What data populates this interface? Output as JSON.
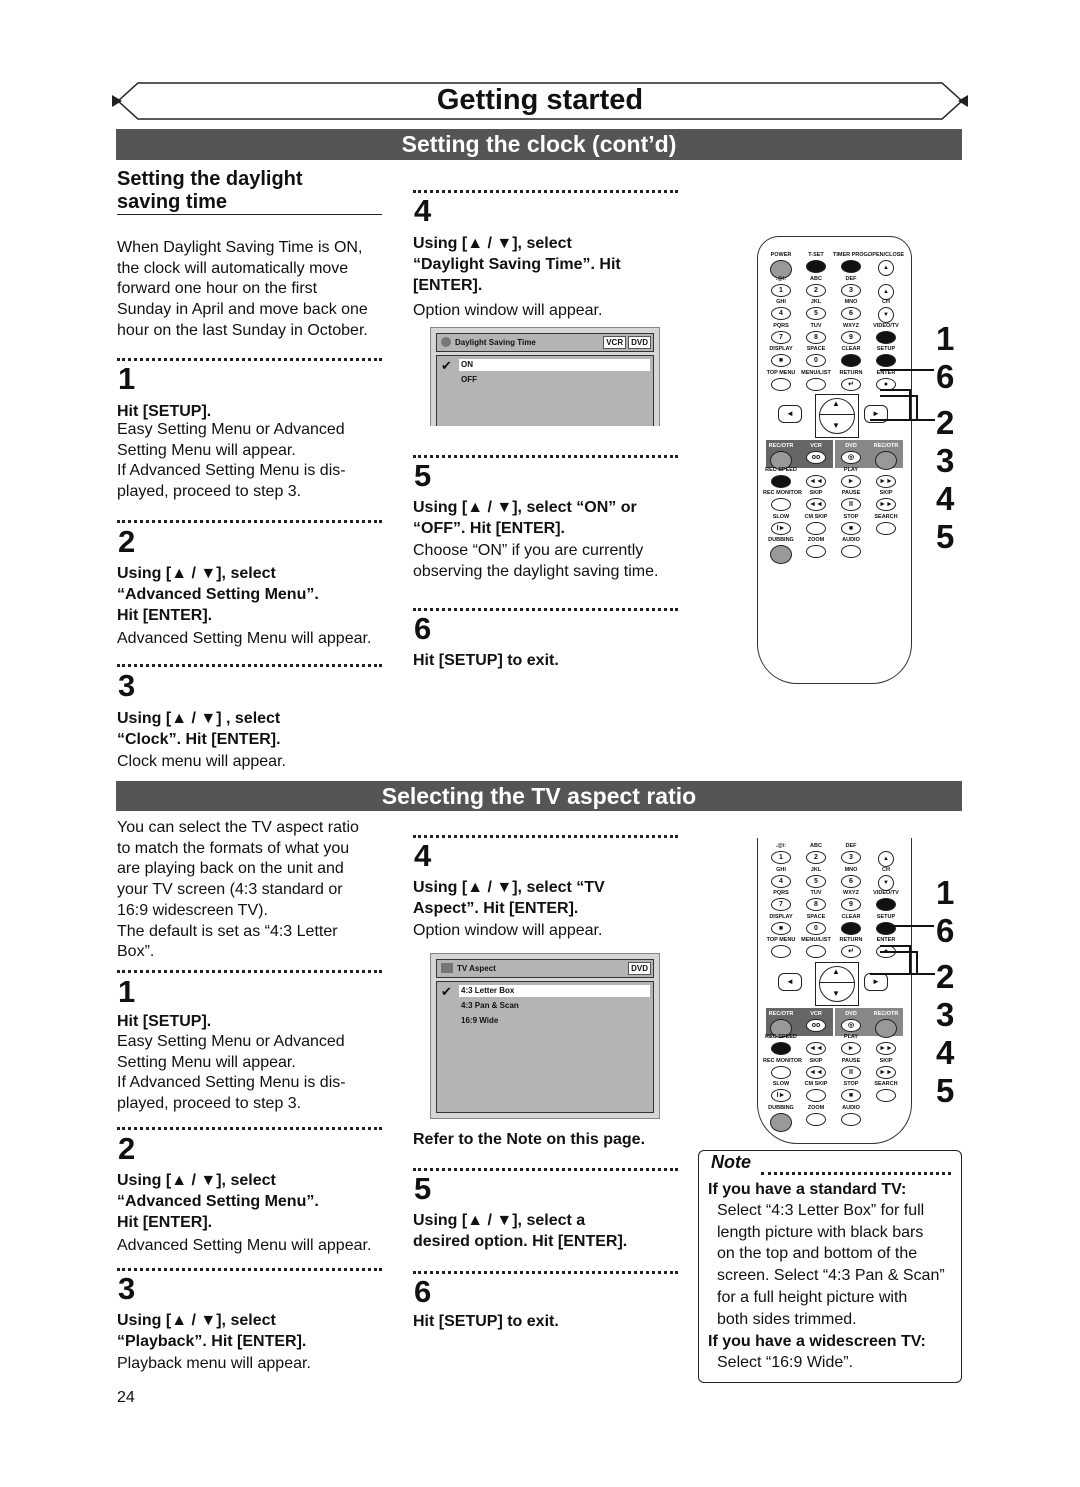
{
  "header": {
    "title": "Getting started"
  },
  "section1": {
    "title": "Setting the clock (cont’d)",
    "subtitle": "Setting the daylight\nsaving time",
    "intro": "When Daylight Saving Time is ON,\nthe clock will automatically move\nforward one hour on the first\nSunday in April and move back one\nhour on the last Sunday in October.",
    "steps": [
      {
        "n": "1",
        "instr": "Hit [SETUP].",
        "text": "Easy Setting Menu or Advanced\nSetting Menu will appear.\nIf Advanced Setting Menu is dis-\nplayed, proceed to step 3."
      },
      {
        "n": "2",
        "instr": "Using [▲ / ▼], select\n“Advanced Setting Menu”.\nHit [ENTER].",
        "text": "Advanced Setting Menu will appear."
      },
      {
        "n": "3",
        "instr": "Using [▲ / ▼] , select\n“Clock”. Hit [ENTER].",
        "text": "Clock menu will appear."
      },
      {
        "n": "4",
        "instr": "Using [▲ / ▼], select\n“Daylight Saving Time”. Hit\n[ENTER].",
        "text": "Option window will appear."
      },
      {
        "n": "5",
        "instr": "Using [▲ / ▼], select “ON” or\n“OFF”. Hit [ENTER].",
        "text": "Choose “ON” if you are currently\nobserving the daylight saving time."
      },
      {
        "n": "6",
        "instr": "Hit [SETUP] to exit.",
        "text": ""
      }
    ],
    "window": {
      "title": "Daylight Saving Time",
      "tags": [
        "VCR",
        "DVD"
      ],
      "options": [
        "ON",
        "OFF"
      ],
      "selected": "ON"
    }
  },
  "section2": {
    "title": "Selecting the TV aspect ratio",
    "intro": "You can select the TV aspect ratio\nto match the formats of what you\nare playing back on the unit and\nyour TV screen (4:3 standard or\n16:9 widescreen TV).\nThe default is set as “4:3 Letter\nBox”.",
    "steps": [
      {
        "n": "1",
        "instr": "Hit [SETUP].",
        "text": "Easy Setting Menu or Advanced\nSetting Menu will appear.\nIf Advanced Setting Menu is dis-\nplayed, proceed to step 3."
      },
      {
        "n": "2",
        "instr": "Using [▲ / ▼], select\n“Advanced Setting Menu”.\nHit [ENTER].",
        "text": "Advanced Setting Menu will appear."
      },
      {
        "n": "3",
        "instr": "Using [▲ / ▼], select\n“Playback”. Hit [ENTER].",
        "text": "Playback menu will appear."
      },
      {
        "n": "4",
        "instr": "Using [▲ / ▼], select “TV\nAspect”. Hit [ENTER].",
        "text": "Option window will appear."
      },
      {
        "n": "5",
        "instr": "Using [▲ / ▼], select a\ndesired option. Hit [ENTER].",
        "text": ""
      },
      {
        "n": "6",
        "instr": "Hit [SETUP] to exit.",
        "text": ""
      }
    ],
    "refer": "Refer to the Note on this page.",
    "window": {
      "title": "TV Aspect",
      "tags": [
        "DVD"
      ],
      "options": [
        "4:3 Letter Box",
        "4:3 Pan & Scan",
        "16:9 Wide"
      ],
      "selected": "4:3 Letter Box"
    },
    "note": {
      "title": "Note",
      "h1": "If you have a standard TV:",
      "t1": "Select “4:3 Letter Box” for full\nlength picture with black bars\non the top and bottom of the\nscreen. Select “4:3 Pan & Scan”\nfor a full height picture with\nboth sides trimmed.",
      "h2": "If you have a widescreen TV:",
      "t2": "Select “16:9 Wide”."
    }
  },
  "remote": {
    "callouts": [
      "1",
      "6",
      "2",
      "3",
      "4",
      "5"
    ],
    "rows": [
      [
        [
          "POWER",
          "",
          "gray"
        ],
        [
          "T-SET",
          "",
          "black"
        ],
        [
          "TIMER PROG.",
          "",
          "black"
        ],
        [
          "OPEN/CLOSE",
          "▲",
          "circle"
        ]
      ],
      [
        [
          ".@/:",
          "1",
          ""
        ],
        [
          "ABC",
          "2",
          ""
        ],
        [
          "DEF",
          "3",
          ""
        ],
        [
          "",
          "▲",
          "circle"
        ]
      ],
      [
        [
          "GHI",
          "4",
          ""
        ],
        [
          "JKL",
          "5",
          ""
        ],
        [
          "MNO",
          "6",
          ""
        ],
        [
          "CH",
          "▼",
          "circle"
        ]
      ],
      [
        [
          "PQRS",
          "7",
          ""
        ],
        [
          "TUV",
          "8",
          ""
        ],
        [
          "WXYZ",
          "9",
          ""
        ],
        [
          "VIDEO/TV",
          "",
          "black"
        ]
      ],
      [
        [
          "DISPLAY",
          "■",
          ""
        ],
        [
          "SPACE",
          "0",
          ""
        ],
        [
          "CLEAR",
          "",
          "black"
        ],
        [
          "SETUP",
          "",
          "black"
        ]
      ],
      [
        [
          "TOP MENU",
          "",
          ""
        ],
        [
          "MENU/LIST",
          "",
          ""
        ],
        [
          "RETURN",
          "↵",
          ""
        ],
        [
          "ENTER",
          "●",
          ""
        ]
      ],
      [
        [
          "REC/OTR",
          "",
          "gray"
        ],
        [
          "VCR",
          "oo",
          ""
        ],
        [
          "DVD",
          "◎",
          ""
        ],
        [
          "REC/OTR",
          "",
          "gray"
        ]
      ],
      [
        [
          "REC SPEED",
          "",
          "black"
        ],
        [
          "",
          "◄◄",
          ""
        ],
        [
          "PLAY",
          "►",
          ""
        ],
        [
          "",
          "►►",
          ""
        ]
      ],
      [
        [
          "REC MONITOR",
          "",
          ""
        ],
        [
          "SKIP",
          "◄◄",
          ""
        ],
        [
          "PAUSE",
          "II",
          ""
        ],
        [
          "SKIP",
          "►►",
          ""
        ]
      ],
      [
        [
          "SLOW",
          "I►",
          ""
        ],
        [
          "CM SKIP",
          "",
          ""
        ],
        [
          "STOP",
          "■",
          ""
        ],
        [
          "SEARCH",
          "",
          ""
        ]
      ],
      [
        [
          "DUBBING",
          "",
          "gray"
        ],
        [
          "ZOOM",
          "",
          ""
        ],
        [
          "AUDIO",
          "",
          ""
        ]
      ]
    ],
    "nav": [
      "◄",
      "▲",
      "▼",
      "►"
    ]
  },
  "footer": {
    "page_number": "24"
  }
}
